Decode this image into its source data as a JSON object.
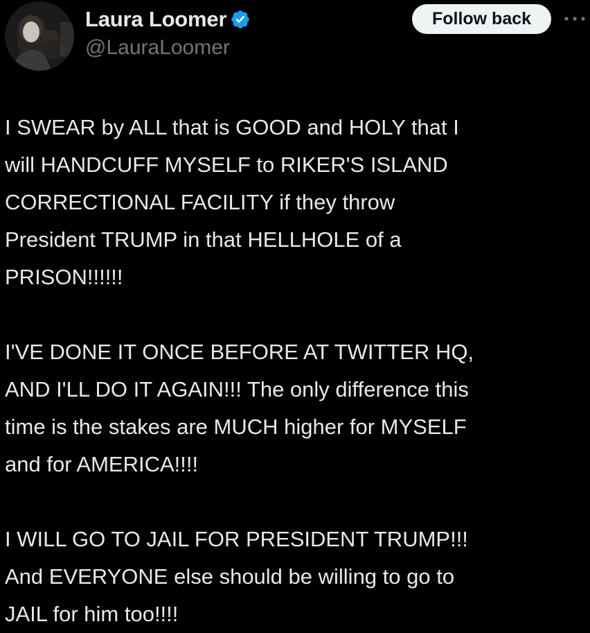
{
  "author": {
    "display_name": "Laura Loomer",
    "handle": "@LauraLoomer",
    "verified_icon": "verified-badge-icon",
    "verified_color": "#1d9bf0",
    "avatar_icon": "profile-avatar"
  },
  "actions": {
    "follow_label": "Follow back",
    "more_icon": "more-options-icon"
  },
  "tweet": {
    "paragraphs": [
      "I SWEAR by ALL that is GOOD and HOLY that I\nwill HANDCUFF MYSELF to RIKER'S ISLAND\nCORRECTIONAL FACILITY if they throw\nPresident TRUMP in that HELLHOLE of a\nPRISON!!!!!!",
      "I'VE DONE IT ONCE BEFORE AT TWITTER HQ,\nAND I'LL DO IT AGAIN!!! The only difference this\ntime is the stakes are MUCH higher for MYSELF\nand for AMERICA!!!!",
      "I WILL GO TO JAIL FOR PRESIDENT TRUMP!!!\nAnd EVERYONE else should be willing to go to\nJAIL for him too!!!!"
    ]
  },
  "colors": {
    "background": "#000000",
    "text": "#e7e9ea",
    "secondary_text": "#71767b",
    "button_bg": "#eff3f4"
  }
}
